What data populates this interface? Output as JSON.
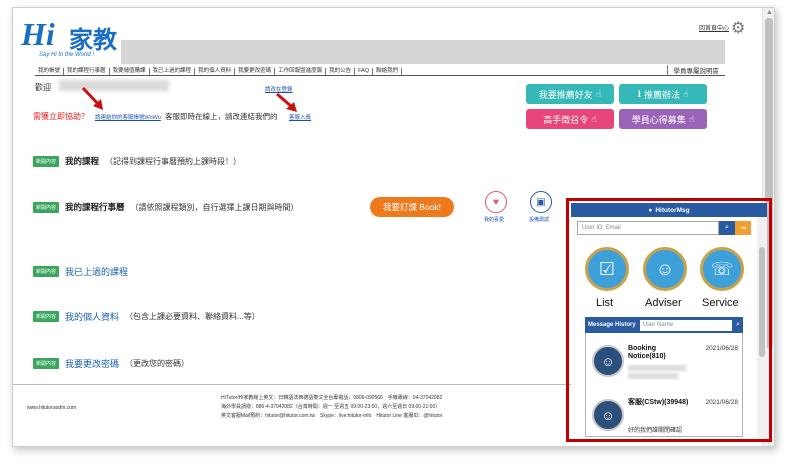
{
  "header": {
    "logo_hi": "Hi",
    "logo_jia": "家教",
    "slogan": "Say Hi to the World !",
    "top_link": "回首頁中心",
    "gear_icon": "gear-icon"
  },
  "nav": {
    "items": [
      "我的帳號",
      "我的課程行事曆",
      "我要儲值購課",
      "我已上過的課程",
      "我的個人資料",
      "我要更改密碼",
      "工作回報暨進度報",
      "我的公告",
      "FAQ",
      "聯絡我們"
    ],
    "right": "學員專屬說明區"
  },
  "welcome": {
    "label": "歡迎"
  },
  "help": {
    "question": "需獲立即協助？",
    "link1": "請連結你的客服帳號WoWu",
    "middle": "客服即時在線上，請改連結我們的",
    "link2": "客服入員",
    "top_small": "請改在登錄"
  },
  "buttons": {
    "recommend_friend": "我要推薦好友",
    "recommend_method": "推薦辦法",
    "summon_expert": "高手徵召令",
    "feedback_collect": "學員心得募集",
    "info_icon": "info-icon",
    "hand_icon": "pointing-hand-icon"
  },
  "sections": {
    "badge": "新開內容",
    "my_course": "我的課程",
    "my_course_desc": "（記得到課程行事曆預約上課時段！）",
    "calendar": "我的課程行事曆",
    "calendar_desc": "（請依照課程類別，自行選擇上課日期與時間）",
    "book_btn": "我要訂課 Book!",
    "past_courses": "我已上過的課程",
    "profile": "我的個人資料",
    "profile_desc": "（包含上課必要資料、聯絡資料...等）",
    "password": "我要更改密碼",
    "password_desc": "（更改您的密碼）",
    "icon1_label": "我的喜愛",
    "icon2_label": "設備測試"
  },
  "footer": {
    "url": "www.hitutoraodm.com",
    "line1": "HiTutor/Hi家教線上英文：日韓語法西德語泰文全台專電話：0809-090566　手機專線：04-37042082",
    "line2": "海外學員請撥：886-4-37042082（台灣時間：週一 至週五 09:00-23:00，週六至週日 09:00-21:00）",
    "line3": "英文客服Mail預約：hitutor@hitutor.com.tw　Skype：live:hitutor-info　Hitutor Line 客服ID：@hitutor"
  },
  "chat": {
    "title": "HitutorMsg",
    "search_placeholder": "User ID, Email",
    "list_label": "List",
    "adviser_label": "Adviser",
    "service_label": "Service",
    "history_label": "Message History",
    "username_placeholder": "User Name",
    "item1_name": "Booking Notice(810)",
    "item1_date": "2021/06/28",
    "item2_name": "客服(CStw)(39948)",
    "item2_date": "2021/06/28",
    "item2_msg": "好的我們誰關閉確認"
  },
  "colors": {
    "teal": "#35b8b8",
    "pink": "#e8457a",
    "purple": "#9b63b7",
    "orange": "#ee7a1e",
    "chat_blue": "#2a5aa0",
    "highlight_red": "#c00000"
  }
}
